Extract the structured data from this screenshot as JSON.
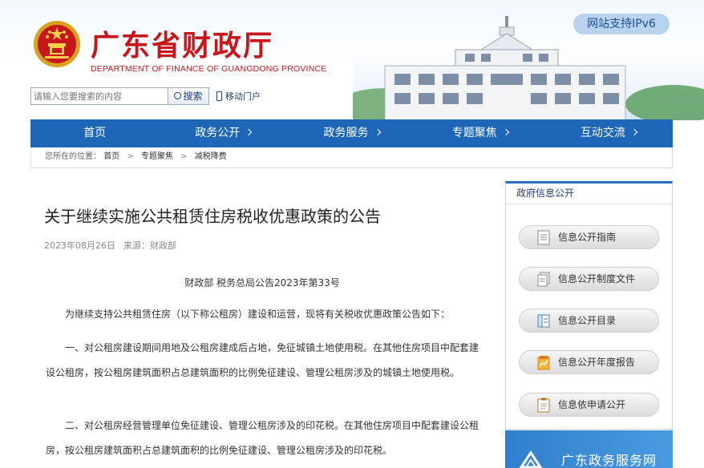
{
  "header": {
    "site_title": "广东省财政厅",
    "site_subtitle": "DEPARTMENT OF FINANCE OF GUANGDONG PROVINCE",
    "ipv6_badge": "网站支持IPv6",
    "search_placeholder": "请输入您要搜索的内容",
    "search_button": "搜索",
    "mobile_link": "移动门户"
  },
  "nav": {
    "items": [
      {
        "label": "首页"
      },
      {
        "label": "政务公开"
      },
      {
        "label": "政务服务"
      },
      {
        "label": "专题聚焦"
      },
      {
        "label": "互动交流"
      }
    ]
  },
  "breadcrumb": {
    "prefix": "您所在的位置：",
    "items": [
      "首页",
      "专题聚焦",
      "减税降费"
    ],
    "separator": ">"
  },
  "article": {
    "title": "关于继续实施公共租赁住房税收优惠政策的公告",
    "date": "2023年08月26日",
    "source": "来源：财政部",
    "doc_number": "财政部 税务总局公告2023年第33号",
    "paragraphs": [
      "为继续支持公共租赁住房（以下称公租房）建设和运营，现将有关税收优惠政策公告如下：",
      "一、对公租房建设期间用地及公租房建成后占地，免征城镇土地使用税。在其他住房项目中配套建设公租房，按公租房建筑面积占总建筑面积的比例免征建设、管理公租房涉及的城镇土地使用税。",
      "二、对公租房经营管理单位免征建设、管理公租房涉及的印花税。在其他住房项目中配套建设公租房，按公租房建筑面积占总建筑面积的比例免征建设、管理公租房涉及的印花税。"
    ]
  },
  "sidebar": {
    "title": "政府信息公开",
    "buttons": [
      {
        "label": "信息公开指南",
        "icon": "document-icon"
      },
      {
        "label": "信息公开制度文件",
        "icon": "files-icon"
      },
      {
        "label": "信息公开目录",
        "icon": "directory-icon"
      },
      {
        "label": "信息公开年度报告",
        "icon": "report-icon"
      },
      {
        "label": "信息依申请公开",
        "icon": "clipboard-icon"
      }
    ]
  },
  "gov_service_banner": {
    "label": "广东政务服务网"
  },
  "colors": {
    "brand_red": "#c8161d",
    "nav_blue": "#1d66b8",
    "ipv6_bg": "#b9d2ee"
  }
}
